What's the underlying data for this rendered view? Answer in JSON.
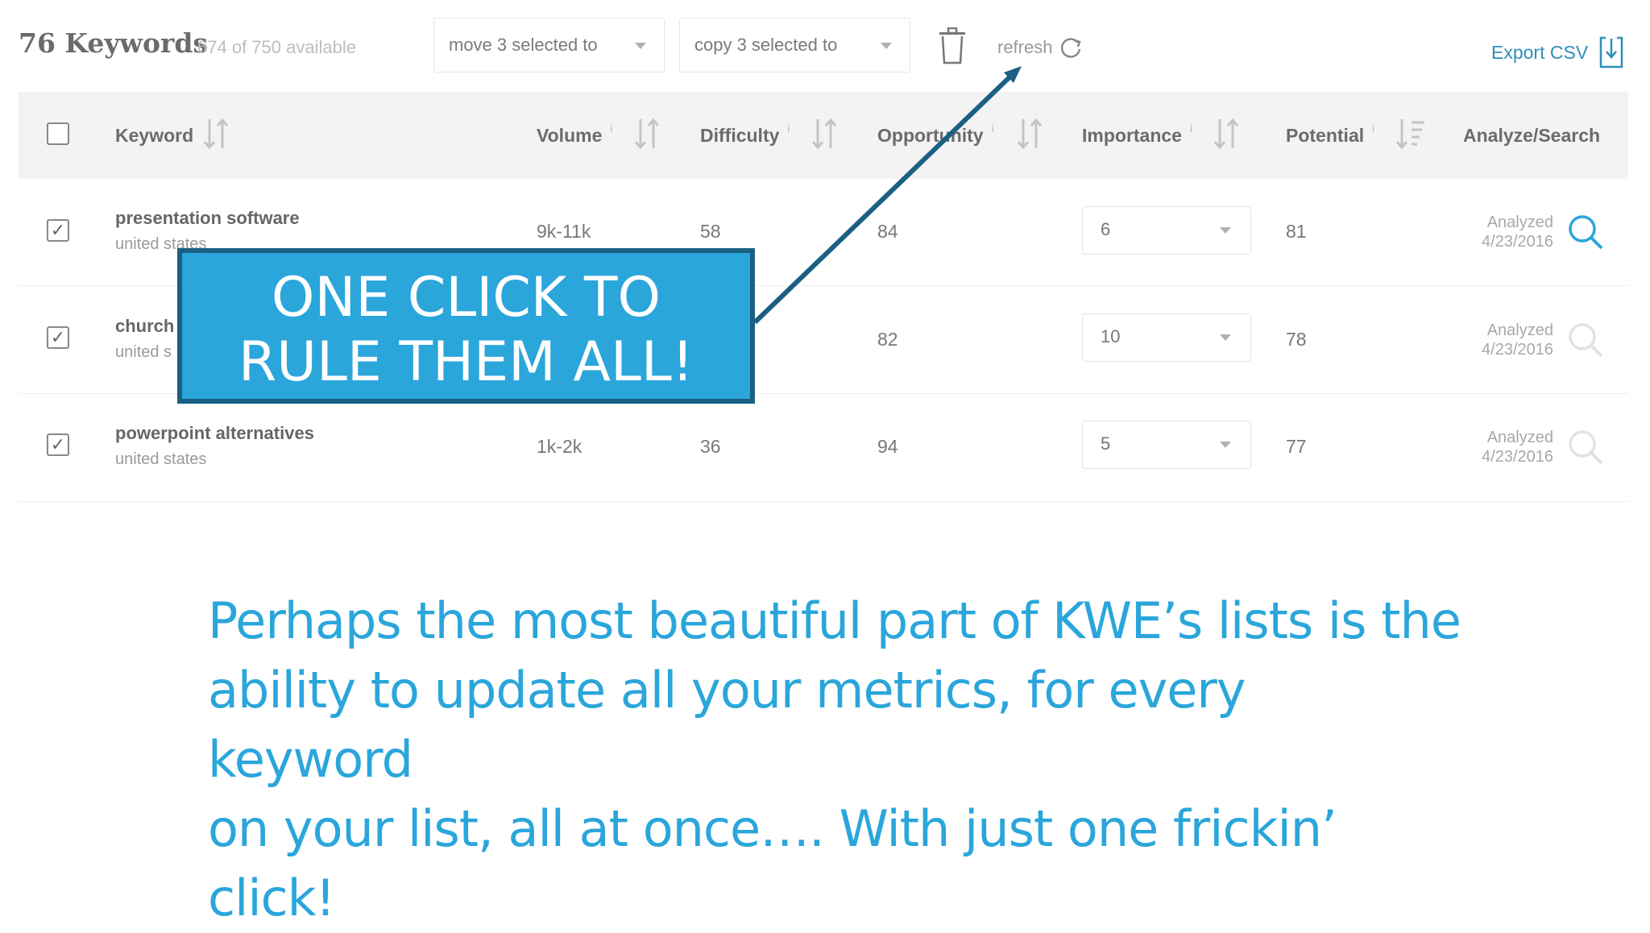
{
  "toolbar": {
    "keyword_count": "76 Keywords",
    "available": "674 of 750 available",
    "move_label": "move 3 selected to",
    "copy_label": "copy 3 selected to",
    "refresh_label": "refresh",
    "export_label": "Export CSV"
  },
  "table": {
    "headers": {
      "keyword": "Keyword",
      "volume": "Volume",
      "difficulty": "Difficulty",
      "opportunity": "Opportunity",
      "importance": "Importance",
      "potential": "Potential",
      "analyze": "Analyze/Search",
      "info": "i"
    },
    "rows": [
      {
        "checked": "✓",
        "keyword": "presentation software",
        "location": "united states",
        "volume": "9k-11k",
        "difficulty": "58",
        "opportunity": "84",
        "importance": "6",
        "potential": "81",
        "analyzed": "Analyzed",
        "date": "4/23/2016"
      },
      {
        "checked": "✓",
        "keyword": "church",
        "location": "united s",
        "volume": "",
        "difficulty": "",
        "opportunity": "82",
        "importance": "10",
        "potential": "78",
        "analyzed": "Analyzed",
        "date": "4/23/2016"
      },
      {
        "checked": "✓",
        "keyword": "powerpoint alternatives",
        "location": "united states",
        "volume": "1k-2k",
        "difficulty": "36",
        "opportunity": "94",
        "importance": "5",
        "potential": "77",
        "analyzed": "Analyzed",
        "date": "4/23/2016"
      }
    ]
  },
  "callout": {
    "line1": "ONE CLICK TO",
    "line2": "RULE THEM ALL!"
  },
  "caption": {
    "line1": "Perhaps the most beautiful part of KWE’s lists is the",
    "line2": "ability to update all your metrics, for every keyword",
    "line3": "on your list, all at once…. With just one frickin’ click!"
  },
  "colors": {
    "accent": "#2aa6db",
    "callout_border": "#1b5f83",
    "link": "#2c8fb8"
  }
}
